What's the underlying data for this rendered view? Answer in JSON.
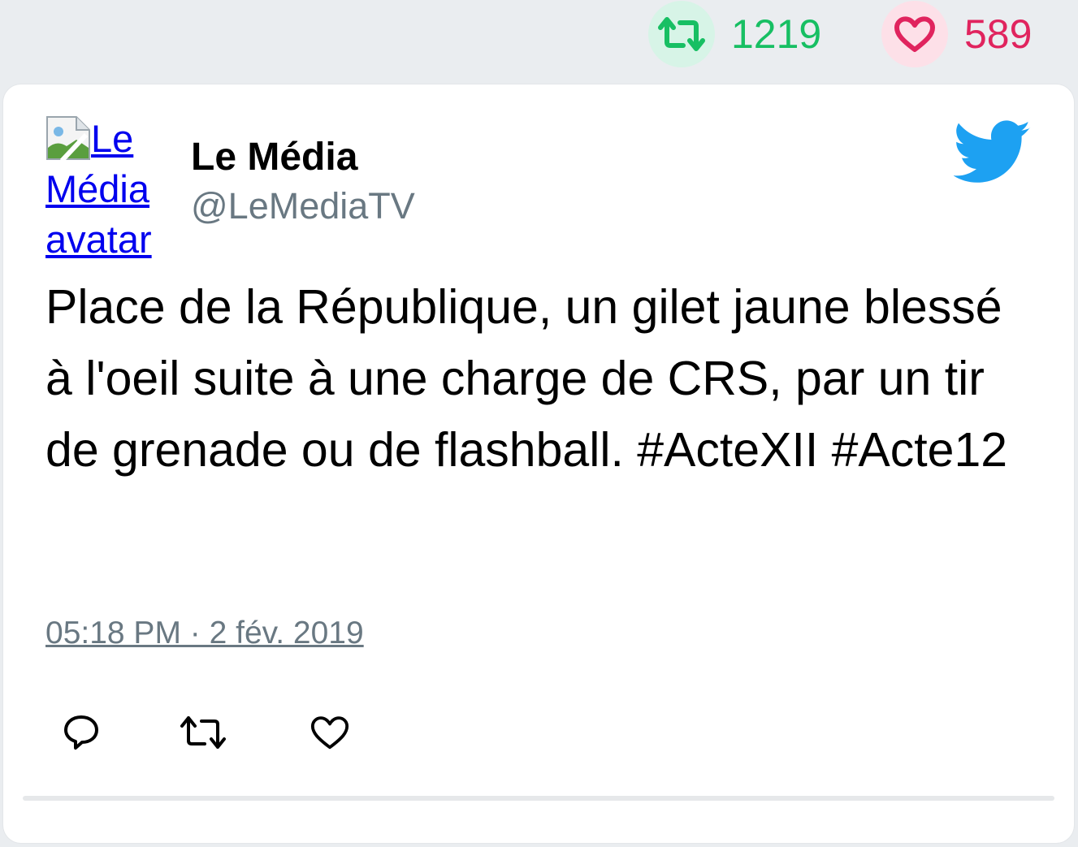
{
  "stats": {
    "retweet_count": "1219",
    "like_count": "589",
    "retweet_color": "#17bf63",
    "like_color": "#e0245e",
    "retweet_icon": "retweet-icon",
    "like_icon": "heart-icon"
  },
  "tweet": {
    "avatar_alt": "Le Média avatar",
    "author_name": "Le Média",
    "author_handle": "@LeMediaTV",
    "logo_icon": "twitter-bird-icon",
    "text": "Place de la République, un gilet jaune blessé à l'oeil suite à une charge de CRS, par un tir de grenade ou de flashball. #ActeXII #Acte12",
    "timestamp": "05:18 PM · 2 fév. 2019"
  },
  "actions": {
    "reply_icon": "reply-icon",
    "retweet_icon": "retweet-icon",
    "like_icon": "heart-icon"
  }
}
